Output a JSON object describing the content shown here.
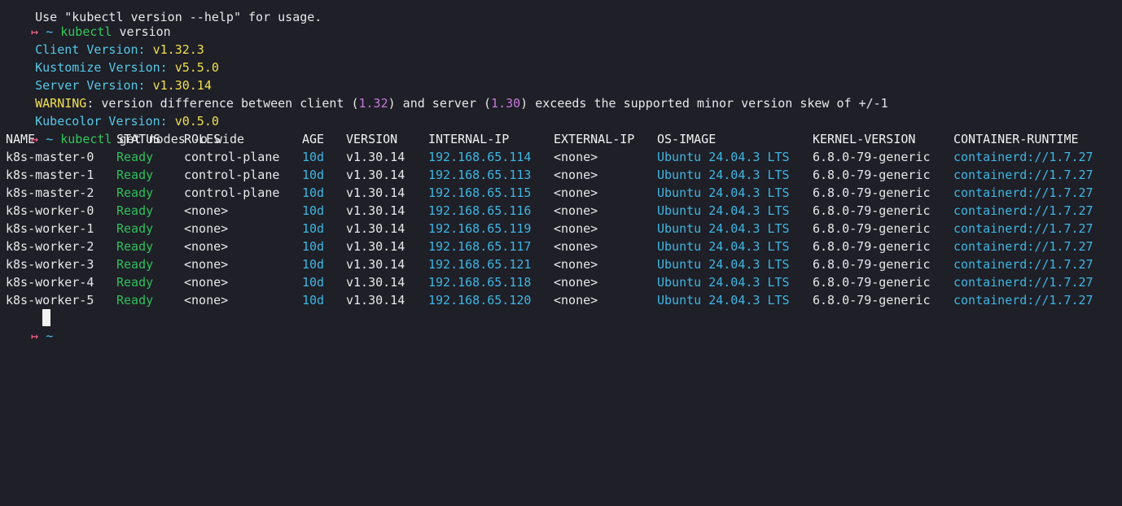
{
  "terminal": {
    "top_partial": "Use \"kubectl version --help\" for usage.",
    "prompt": {
      "arrow": "↦",
      "tilde": "~"
    },
    "cmd1": {
      "name": "kubectl",
      "args": " version"
    },
    "client_label": "Client Version:",
    "client_value": "v1.32.3",
    "kustomize_label": "Kustomize Version:",
    "kustomize_value": "v5.5.0",
    "server_label": "Server Version:",
    "server_value": "v1.30.14",
    "warning_label": "WARNING",
    "warning_text_1": ": version difference between client (",
    "warning_client": "1.32",
    "warning_text_2": ") and server (",
    "warning_server": "1.30",
    "warning_text_3": ") exceeds the supported minor version skew of +/-1",
    "kubecolor_label": "Kubecolor Version:",
    "kubecolor_value": "v0.5.0",
    "cmd2": {
      "name": "kubectl",
      "args": " get nodes -o wide"
    },
    "table": {
      "headers": [
        "NAME",
        "STATUS",
        "ROLES",
        "AGE",
        "VERSION",
        "INTERNAL-IP",
        "EXTERNAL-IP",
        "OS-IMAGE",
        "KERNEL-VERSION",
        "CONTAINER-RUNTIME"
      ],
      "rows": [
        [
          "k8s-master-0",
          "Ready",
          "control-plane",
          "10d",
          "v1.30.14",
          "192.168.65.114",
          "<none>",
          "Ubuntu 24.04.3 LTS",
          "6.8.0-79-generic",
          "containerd://1.7.27"
        ],
        [
          "k8s-master-1",
          "Ready",
          "control-plane",
          "10d",
          "v1.30.14",
          "192.168.65.113",
          "<none>",
          "Ubuntu 24.04.3 LTS",
          "6.8.0-79-generic",
          "containerd://1.7.27"
        ],
        [
          "k8s-master-2",
          "Ready",
          "control-plane",
          "10d",
          "v1.30.14",
          "192.168.65.115",
          "<none>",
          "Ubuntu 24.04.3 LTS",
          "6.8.0-79-generic",
          "containerd://1.7.27"
        ],
        [
          "k8s-worker-0",
          "Ready",
          "<none>",
          "10d",
          "v1.30.14",
          "192.168.65.116",
          "<none>",
          "Ubuntu 24.04.3 LTS",
          "6.8.0-79-generic",
          "containerd://1.7.27"
        ],
        [
          "k8s-worker-1",
          "Ready",
          "<none>",
          "10d",
          "v1.30.14",
          "192.168.65.119",
          "<none>",
          "Ubuntu 24.04.3 LTS",
          "6.8.0-79-generic",
          "containerd://1.7.27"
        ],
        [
          "k8s-worker-2",
          "Ready",
          "<none>",
          "10d",
          "v1.30.14",
          "192.168.65.117",
          "<none>",
          "Ubuntu 24.04.3 LTS",
          "6.8.0-79-generic",
          "containerd://1.7.27"
        ],
        [
          "k8s-worker-3",
          "Ready",
          "<none>",
          "10d",
          "v1.30.14",
          "192.168.65.121",
          "<none>",
          "Ubuntu 24.04.3 LTS",
          "6.8.0-79-generic",
          "containerd://1.7.27"
        ],
        [
          "k8s-worker-4",
          "Ready",
          "<none>",
          "10d",
          "v1.30.14",
          "192.168.65.118",
          "<none>",
          "Ubuntu 24.04.3 LTS",
          "6.8.0-79-generic",
          "containerd://1.7.27"
        ],
        [
          "k8s-worker-5",
          "Ready",
          "<none>",
          "10d",
          "v1.30.14",
          "192.168.65.120",
          "<none>",
          "Ubuntu 24.04.3 LTS",
          "6.8.0-79-generic",
          "containerd://1.7.27"
        ]
      ]
    }
  },
  "colors": {
    "background": "#1e1f27",
    "ready": "#2ec05b",
    "ip": "#3fb6e3",
    "label": "#56c8e6",
    "value": "#f1e04d",
    "warning": "#f1e04d",
    "version_skew": "#c678dd"
  }
}
